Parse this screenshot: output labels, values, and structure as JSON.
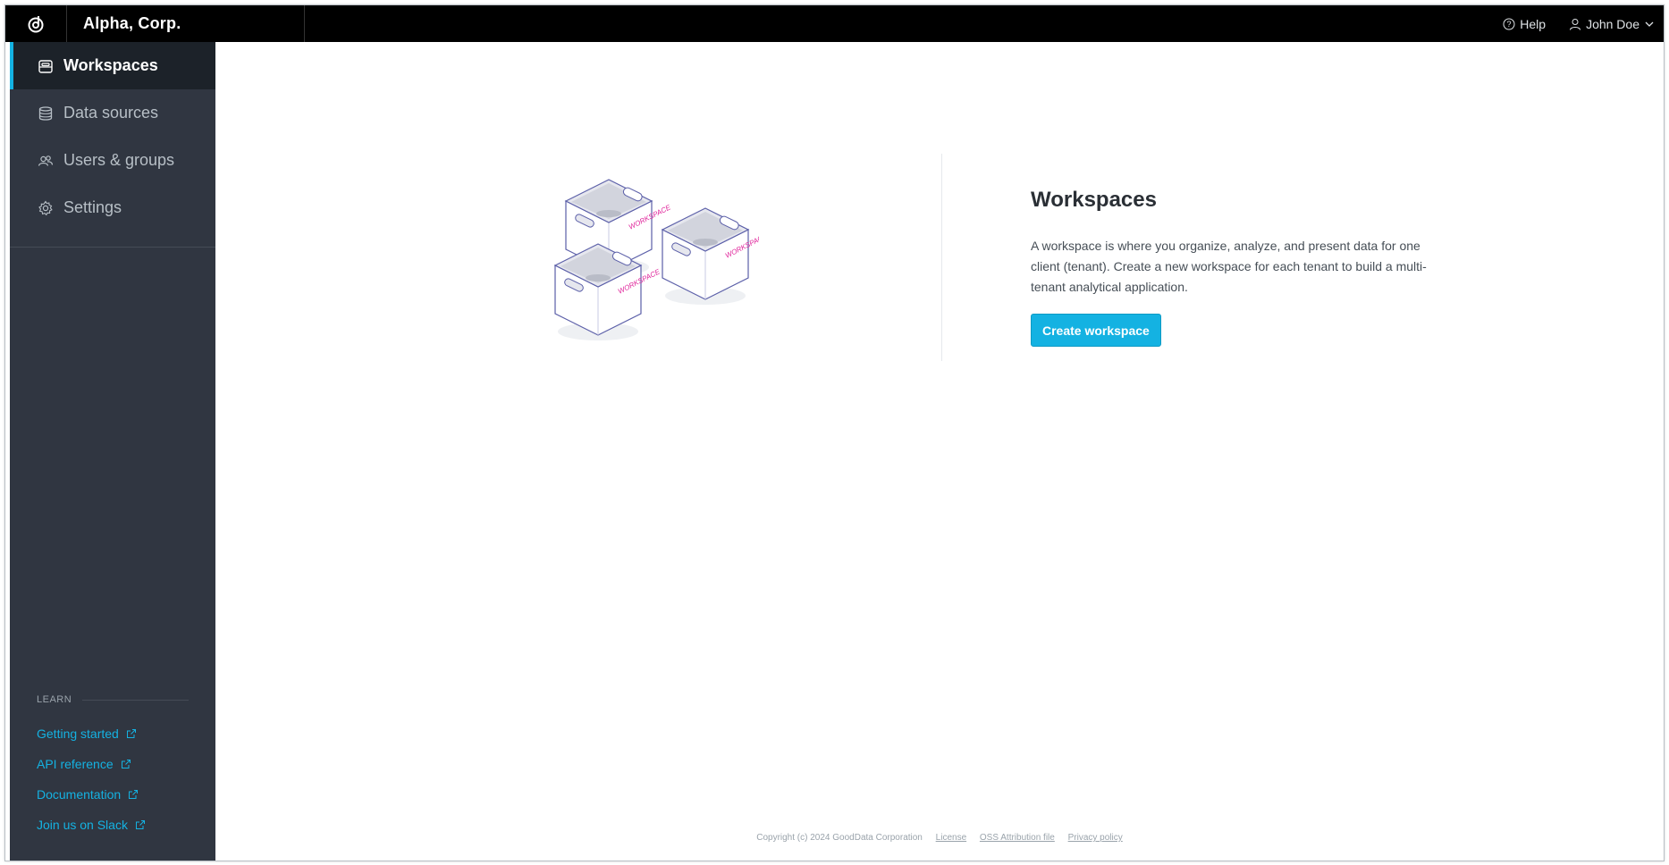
{
  "header": {
    "org_name": "Alpha, Corp.",
    "help_label": "Help",
    "user_name": "John Doe"
  },
  "sidebar": {
    "items": [
      {
        "label": "Workspaces",
        "icon": "workspaces-icon",
        "active": true
      },
      {
        "label": "Data sources",
        "icon": "database-icon",
        "active": false
      },
      {
        "label": "Users & groups",
        "icon": "users-icon",
        "active": false
      },
      {
        "label": "Settings",
        "icon": "gear-icon",
        "active": false
      }
    ],
    "learn": {
      "title": "LEARN",
      "links": [
        {
          "label": "Getting started"
        },
        {
          "label": "API reference"
        },
        {
          "label": "Documentation"
        },
        {
          "label": "Join us on Slack"
        }
      ]
    }
  },
  "main": {
    "title": "Workspaces",
    "description": "A workspace is where you organize, analyze, and present data for one client (tenant). Create a new workspace for each tenant to build a multi-tenant analytical application.",
    "create_button": "Create workspace",
    "box_label": "WORKSPACE"
  },
  "footer": {
    "copyright": "Copyright (c) 2024 GoodData Corporation",
    "license": "License",
    "oss": "OSS Attribution file",
    "privacy": "Privacy policy"
  },
  "colors": {
    "accent": "#14b2e2",
    "sidebar_bg": "#303641",
    "topbar_bg": "#000000",
    "box_label": "#e0259b"
  }
}
